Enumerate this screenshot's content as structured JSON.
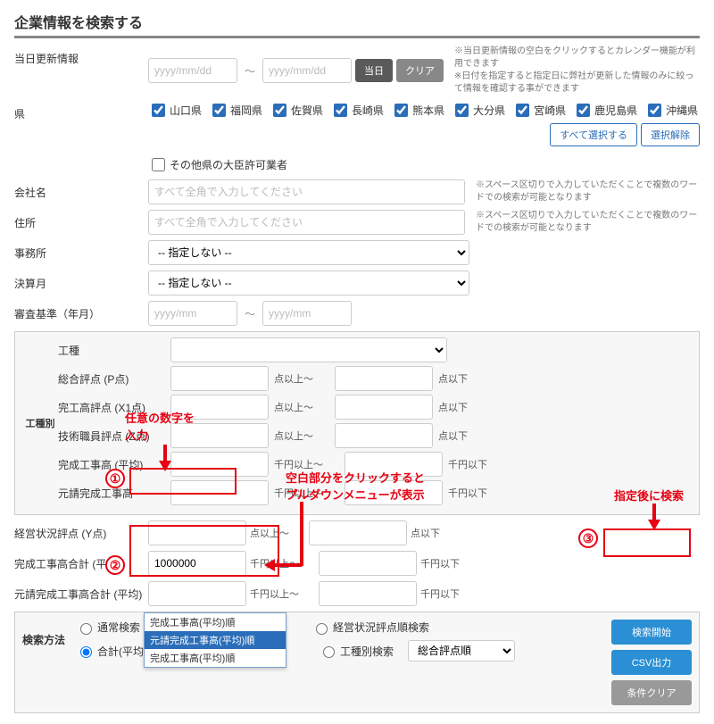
{
  "title": "企業情報を検索する",
  "rows": {
    "update_date": {
      "label": "当日更新情報",
      "placeholder": "yyyy/mm/dd",
      "btn_today": "当日",
      "btn_clear": "クリア",
      "note": "※当日更新情報の空白をクリックするとカレンダー機能が利用できます\n※日付を指定すると指定日に弊社が更新した情報のみに絞って情報を確認する事ができます"
    },
    "prefectures": {
      "label": "県",
      "items": [
        "山口県",
        "福岡県",
        "佐賀県",
        "長崎県",
        "熊本県",
        "大分県",
        "宮崎県",
        "鹿児島県",
        "沖縄県"
      ],
      "other_label": "その他県の大臣許可業者",
      "btn_select_all": "すべて選択する",
      "btn_deselect": "選択解除"
    },
    "company": {
      "label": "会社名",
      "placeholder": "すべて全角で入力してください",
      "note": "※スペース区切りで入力していただくことで複数のワードでの検索が可能となります"
    },
    "address": {
      "label": "住所",
      "placeholder": "すべて全角で入力してください",
      "note": "※スペース区切りで入力していただくことで複数のワードでの検索が可能となります"
    },
    "office": {
      "label": "事務所",
      "placeholder": "-- 指定しない --"
    },
    "closing": {
      "label": "決算月",
      "placeholder": "-- 指定しない --"
    },
    "audit_date": {
      "label": "審査基準（年月）",
      "placeholder": "yyyy/mm"
    }
  },
  "type_box": {
    "label": "工種別",
    "construction_label": "工種",
    "rows": [
      {
        "label": "総合評点 (P点)",
        "unit_low": "点以上～",
        "unit_high": "点以下"
      },
      {
        "label": "完工高評点 (X1点)",
        "unit_low": "点以上～",
        "unit_high": "点以下"
      },
      {
        "label": "技術職員評点 (Z点)",
        "unit_low": "点以上～",
        "unit_high": "点以下"
      },
      {
        "label": "完成工事高 (平均)",
        "unit_low": "千円以上～",
        "unit_high": "千円以下"
      },
      {
        "label": "元請完成工事高",
        "unit_low": "千円以上～",
        "unit_high": "千円以下"
      }
    ]
  },
  "below": [
    {
      "label": "経営状況評点 (Y点)",
      "unit_low": "点以上～",
      "unit_high": "点以下"
    },
    {
      "label": "完成工事高合計 (平均)",
      "value": "1000000",
      "unit_low": "千円以上～",
      "unit_high": "千円以下"
    },
    {
      "label": "元請完成工事高合計 (平均)",
      "unit_low": "千円以上～",
      "unit_high": "千円以下"
    }
  ],
  "search_method": {
    "label": "検索方法",
    "normal": "通常検索",
    "total": "合計(平均)",
    "mgmt": "経営状況評点順検索",
    "bytype": "工種別検索",
    "bytype_select": "総合評点順",
    "dropdown": {
      "opt1": "完成工事高(平均)順",
      "opt2": "元請完成工事高(平均)順",
      "opt3": "完成工事高(平均)順"
    }
  },
  "actions": {
    "search": "検索開始",
    "csv": "CSV出力",
    "clear": "条件クリア"
  },
  "annotations": {
    "input_num": "任意の数字を\n入力",
    "dropdown_hint": "空白部分をクリックすると\nプルダウンメニューが表示",
    "after_search": "指定後に検索"
  }
}
